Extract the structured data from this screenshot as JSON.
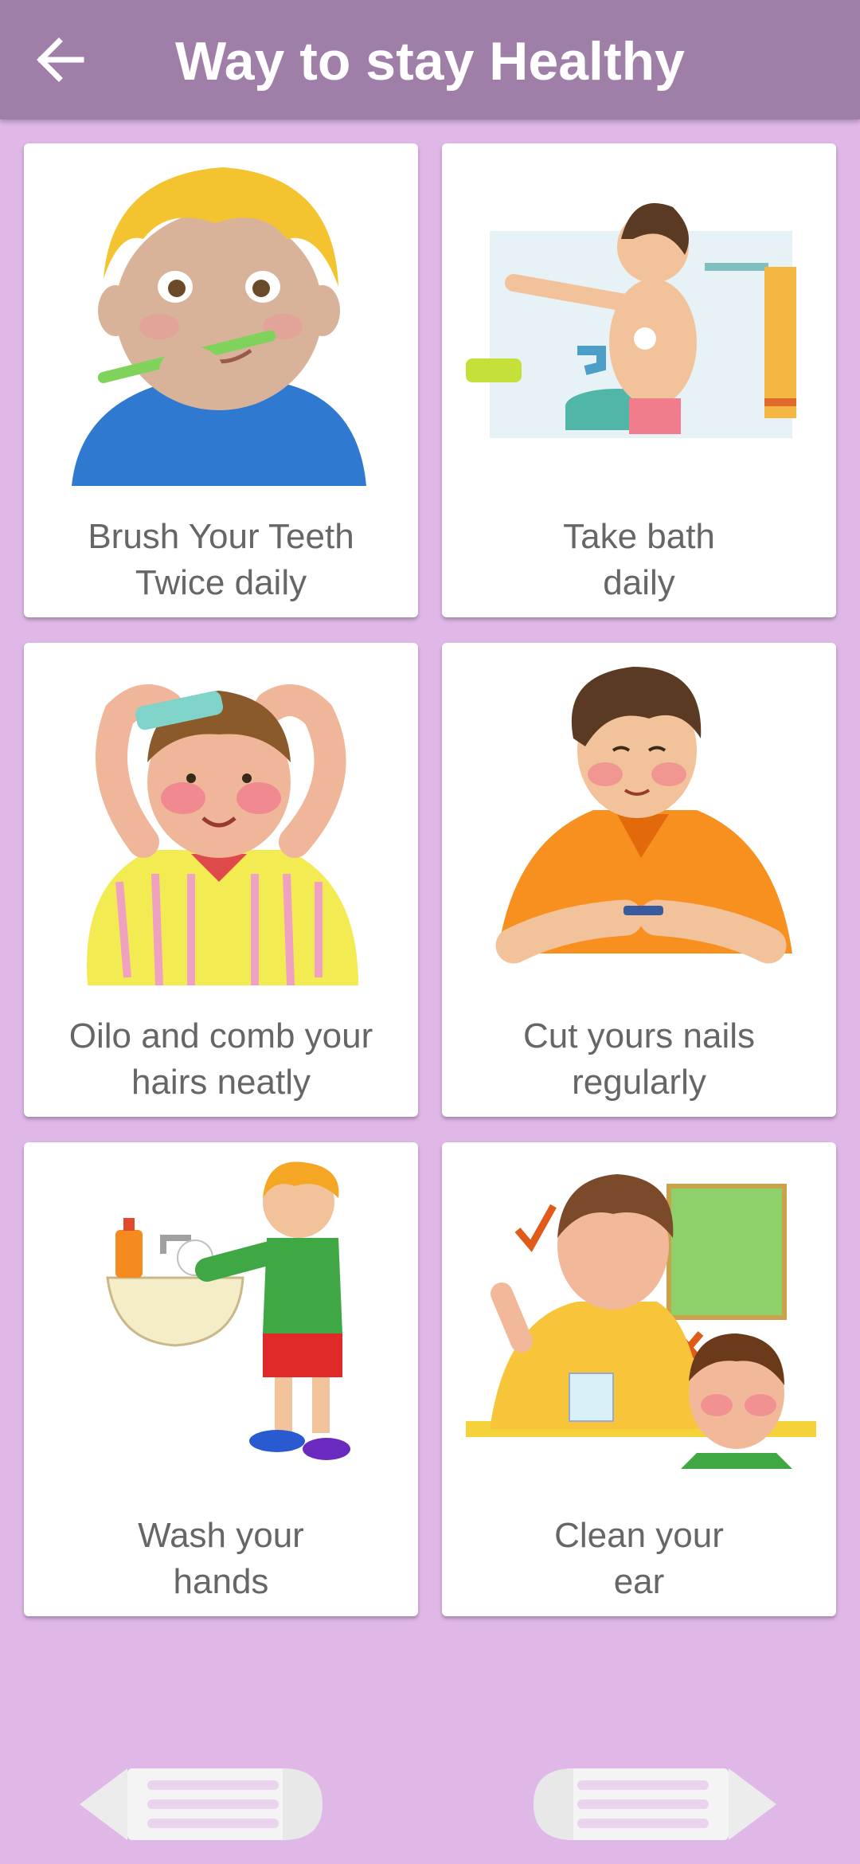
{
  "appbar": {
    "title": "Way to stay Healthy",
    "back_icon": "arrow-left-icon",
    "color": "#9f7fa8"
  },
  "background_color": "#e0b8e8",
  "cards": [
    {
      "line1": "Brush Your Teeth",
      "line2": "Twice daily",
      "image": "boy-brushing-teeth"
    },
    {
      "line1": "Take bath",
      "line2": "daily",
      "image": "boy-bathing"
    },
    {
      "line1": "Oilo and comb your",
      "line2": "hairs neatly",
      "image": "boy-combing-hair"
    },
    {
      "line1": "Cut yours nails",
      "line2": "regularly",
      "image": "boy-cutting-nails"
    },
    {
      "line1": "Wash your",
      "line2": "hands",
      "image": "boy-washing-hands"
    },
    {
      "line1": "Clean your",
      "line2": "ear",
      "image": "boys-cleaning-ears"
    }
  ],
  "navigation": {
    "previous_icon": "pencil-arrow-left-icon",
    "next_icon": "pencil-arrow-right-icon"
  }
}
